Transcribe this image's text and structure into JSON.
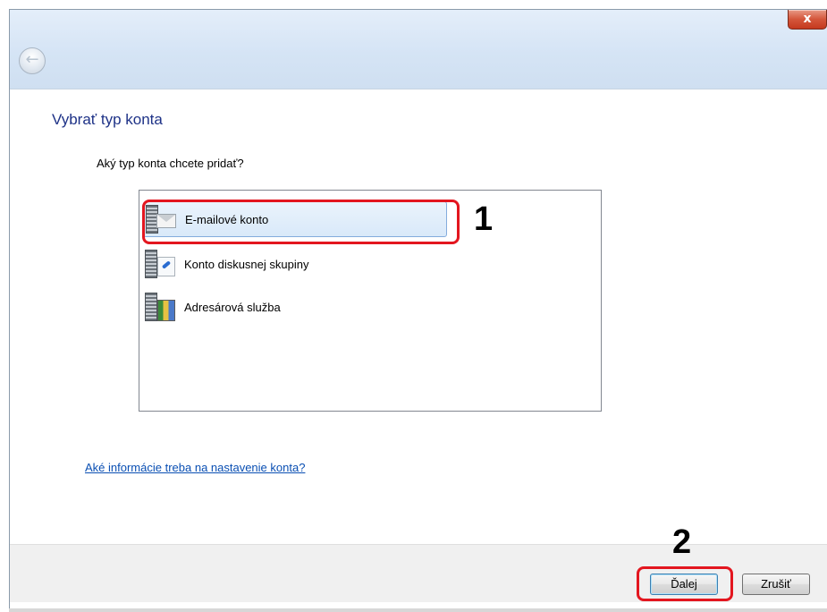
{
  "window": {
    "close_label": "x",
    "back_icon": "back-arrow-icon"
  },
  "page": {
    "title": "Vybrať typ konta",
    "question": "Aký typ konta chcete pridať?"
  },
  "account_types": [
    {
      "label": "E-mailové konto",
      "icon": "email-server-icon",
      "selected": true
    },
    {
      "label": "Konto diskusnej skupiny",
      "icon": "newsgroup-server-icon",
      "selected": false
    },
    {
      "label": "Adresárová služba",
      "icon": "directory-server-icon",
      "selected": false
    }
  ],
  "help_link": "Aké informácie treba na nastavenie konta?",
  "buttons": {
    "next_label": "Ďalej",
    "cancel_label": "Zrušiť"
  },
  "annotations": {
    "step1": "1",
    "step2": "2"
  },
  "colors": {
    "title_blue": "#1e3287",
    "link_blue": "#0a4fb3",
    "callout_red": "#e3161f",
    "selection_blue": "#d9e9f9"
  }
}
